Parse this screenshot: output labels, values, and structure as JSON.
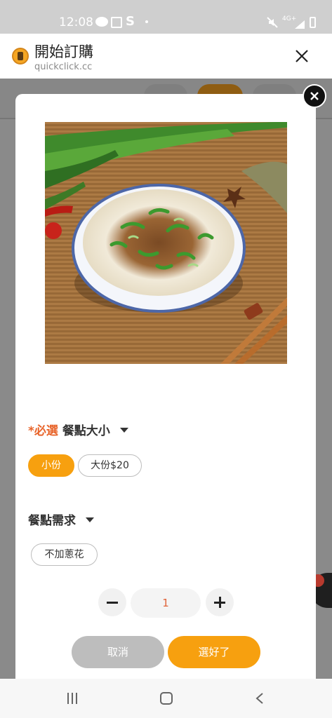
{
  "status_bar": {
    "time": "12:08",
    "network_label": "4G+"
  },
  "app_header": {
    "title": "開始訂購",
    "url": "quickclick.cc"
  },
  "option_group_size": {
    "required_tag": "*必選",
    "title": "餐點大小",
    "options": [
      {
        "label": "小份",
        "selected": true
      },
      {
        "label": "大份$20",
        "selected": false
      }
    ]
  },
  "option_group_needs": {
    "title": "餐點需求",
    "options": [
      {
        "label": "不加蔥花",
        "selected": false
      }
    ]
  },
  "quantity": {
    "value": "1"
  },
  "actions": {
    "cancel_label": "取消",
    "confirm_label": "選好了"
  },
  "colors": {
    "accent": "#f7a00f",
    "required": "#e8642a",
    "cancel_bg": "#bdbdbd"
  }
}
